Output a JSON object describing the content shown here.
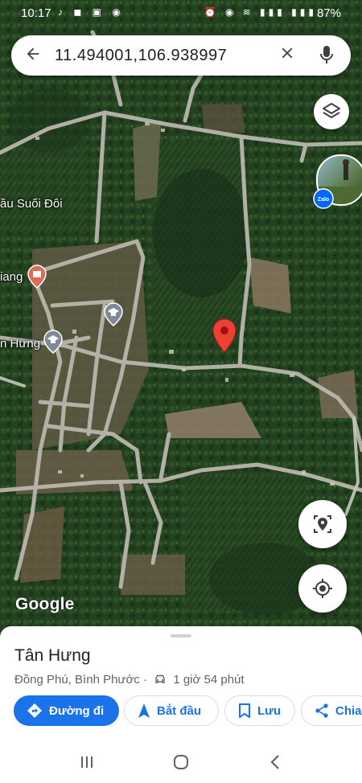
{
  "status_bar": {
    "time": "10:17",
    "battery": "87%"
  },
  "search": {
    "query": "11.494001,106.938997"
  },
  "map_labels": {
    "suoi_doi": "ầu Suối Đôi",
    "giang": "iang",
    "tan_hung": "n Hưng"
  },
  "google_logo": "Google",
  "place": {
    "name": "Tân Hưng",
    "area": "Đồng Phú, Bình Phước",
    "separator": "·",
    "travel_time": "1 giờ 54 phút"
  },
  "actions": {
    "directions": "Đường đi",
    "start": "Bắt đầu",
    "save": "Lưu",
    "share": "Chia"
  },
  "colors": {
    "accent": "#1a73e8",
    "pin": "#ea4335",
    "poi_red": "#e06b55",
    "poi_gray": "#7d8b99"
  },
  "icons": {
    "back": "arrow-left-icon",
    "clear": "close-icon",
    "mic": "microphone-icon",
    "layers": "layers-icon",
    "street_view": "street-view-icon",
    "my_location": "crosshair-icon",
    "pin": "map-pin-icon",
    "car": "car-icon"
  }
}
